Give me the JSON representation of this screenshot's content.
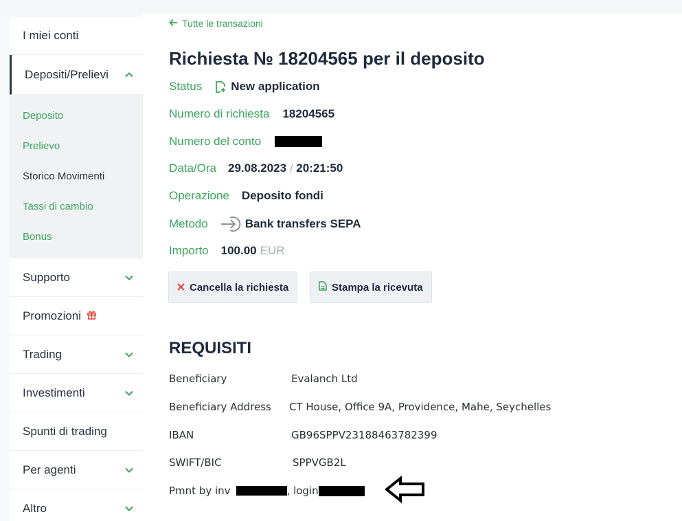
{
  "sidebar": {
    "my_accounts": "I miei conti",
    "deposits": "Depositi/Prelievi",
    "sub_items": [
      {
        "label": "Deposito"
      },
      {
        "label": "Prelievo"
      },
      {
        "label": "Storico Movimenti"
      },
      {
        "label": "Tassi di cambio"
      },
      {
        "label": "Bonus"
      }
    ],
    "support": "Supporto",
    "promotions": "Promozioni",
    "trading": "Trading",
    "investments": "Investimenti",
    "trading_ideas": "Spunti di trading",
    "agents": "Per agenti",
    "other": "Altro"
  },
  "main": {
    "back_link": "Tutte le transazioni",
    "title": "Richiesta № 18204565 per il deposito",
    "status_label": "Status",
    "status_value": "New application",
    "request_number_label": "Numero di richiesta",
    "request_number_value": "18204565",
    "account_label": "Numero del conto",
    "datetime_label": "Data/Ora",
    "date_value": "29.08.2023",
    "datetime_sep": "/",
    "time_value": "20:21:50",
    "operation_label": "Operazione",
    "operation_value": "Deposito fondi",
    "method_label": "Metodo",
    "method_value": "Bank transfers SEPA",
    "amount_label": "Importo",
    "amount_value": "100.00",
    "amount_currency": "EUR",
    "cancel_button": "Cancella la richiesta",
    "print_button": "Stampa la ricevuta"
  },
  "requirements": {
    "title": "REQUISITI",
    "rows": [
      {
        "label": "Beneficiary",
        "value": "Evalanch Ltd"
      },
      {
        "label": "Beneficiary Address",
        "value": "CT House, Office 9A, Providence, Mahe, Seychelles"
      },
      {
        "label": "IBAN",
        "value": "GB96SPPV23188463782399"
      },
      {
        "label": "SWIFT/BIC",
        "value": "SPPVGB2L"
      }
    ],
    "payment_prefix": "Pmnt by inv",
    "payment_mid": ", login"
  },
  "colors": {
    "accent_green": "#3aa55c",
    "text_dark": "#1f2a3c",
    "cancel_red": "#e0453d",
    "gift_red": "#e0453d"
  }
}
